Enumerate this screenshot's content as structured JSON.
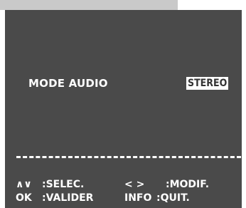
{
  "menu": {
    "label": "MODE AUDIO",
    "value": "STEREO"
  },
  "help": {
    "nav_updown_glyph": "∧∨",
    "nav_updown_label": ":SELEC.",
    "nav_leftright_glyph": "< >",
    "nav_leftright_label": ":MODIF.",
    "ok_key": "OK",
    "ok_label": ":VALIDER",
    "info_key": "INFO",
    "info_label": ":QUIT."
  },
  "colors": {
    "panel_background": "#4a4a4a",
    "text": "#ffffff",
    "value_box_background": "#ffffff",
    "value_box_text": "#333333"
  }
}
